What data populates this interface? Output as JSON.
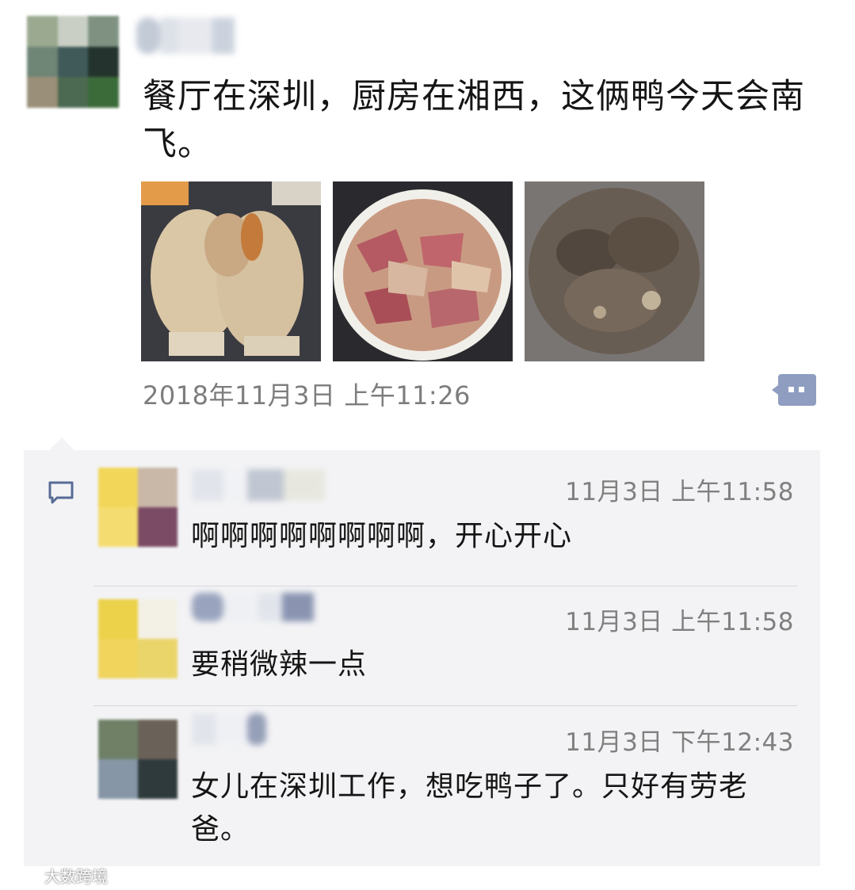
{
  "post": {
    "text": "餐厅在深圳，厨房在湘西，这俩鸭今天会南飞。",
    "time": "2018年11月3日 上午11:26",
    "photos": [
      {
        "name": "raw-ducks-photo"
      },
      {
        "name": "sliced-duck-meat-photo"
      },
      {
        "name": "cooking-pot-photo"
      }
    ]
  },
  "comments": [
    {
      "time": "11月3日 上午11:58",
      "text": "啊啊啊啊啊啊啊啊，开心开心"
    },
    {
      "time": "11月3日 上午11:58",
      "text": "要稍微辣一点"
    },
    {
      "time": "11月3日 下午12:43",
      "text": "女儿在深圳工作，想吃鸭子了。只好有劳老爸。"
    }
  ],
  "watermark": {
    "text": "大数跨境"
  },
  "colors": {
    "panel_bg": "#f3f3f5",
    "link_blue": "#576b95",
    "time_gray": "#7d7d7d"
  },
  "icons": [
    "more-actions-icon",
    "comment-bubble-icon",
    "weibo-logo-icon"
  ]
}
